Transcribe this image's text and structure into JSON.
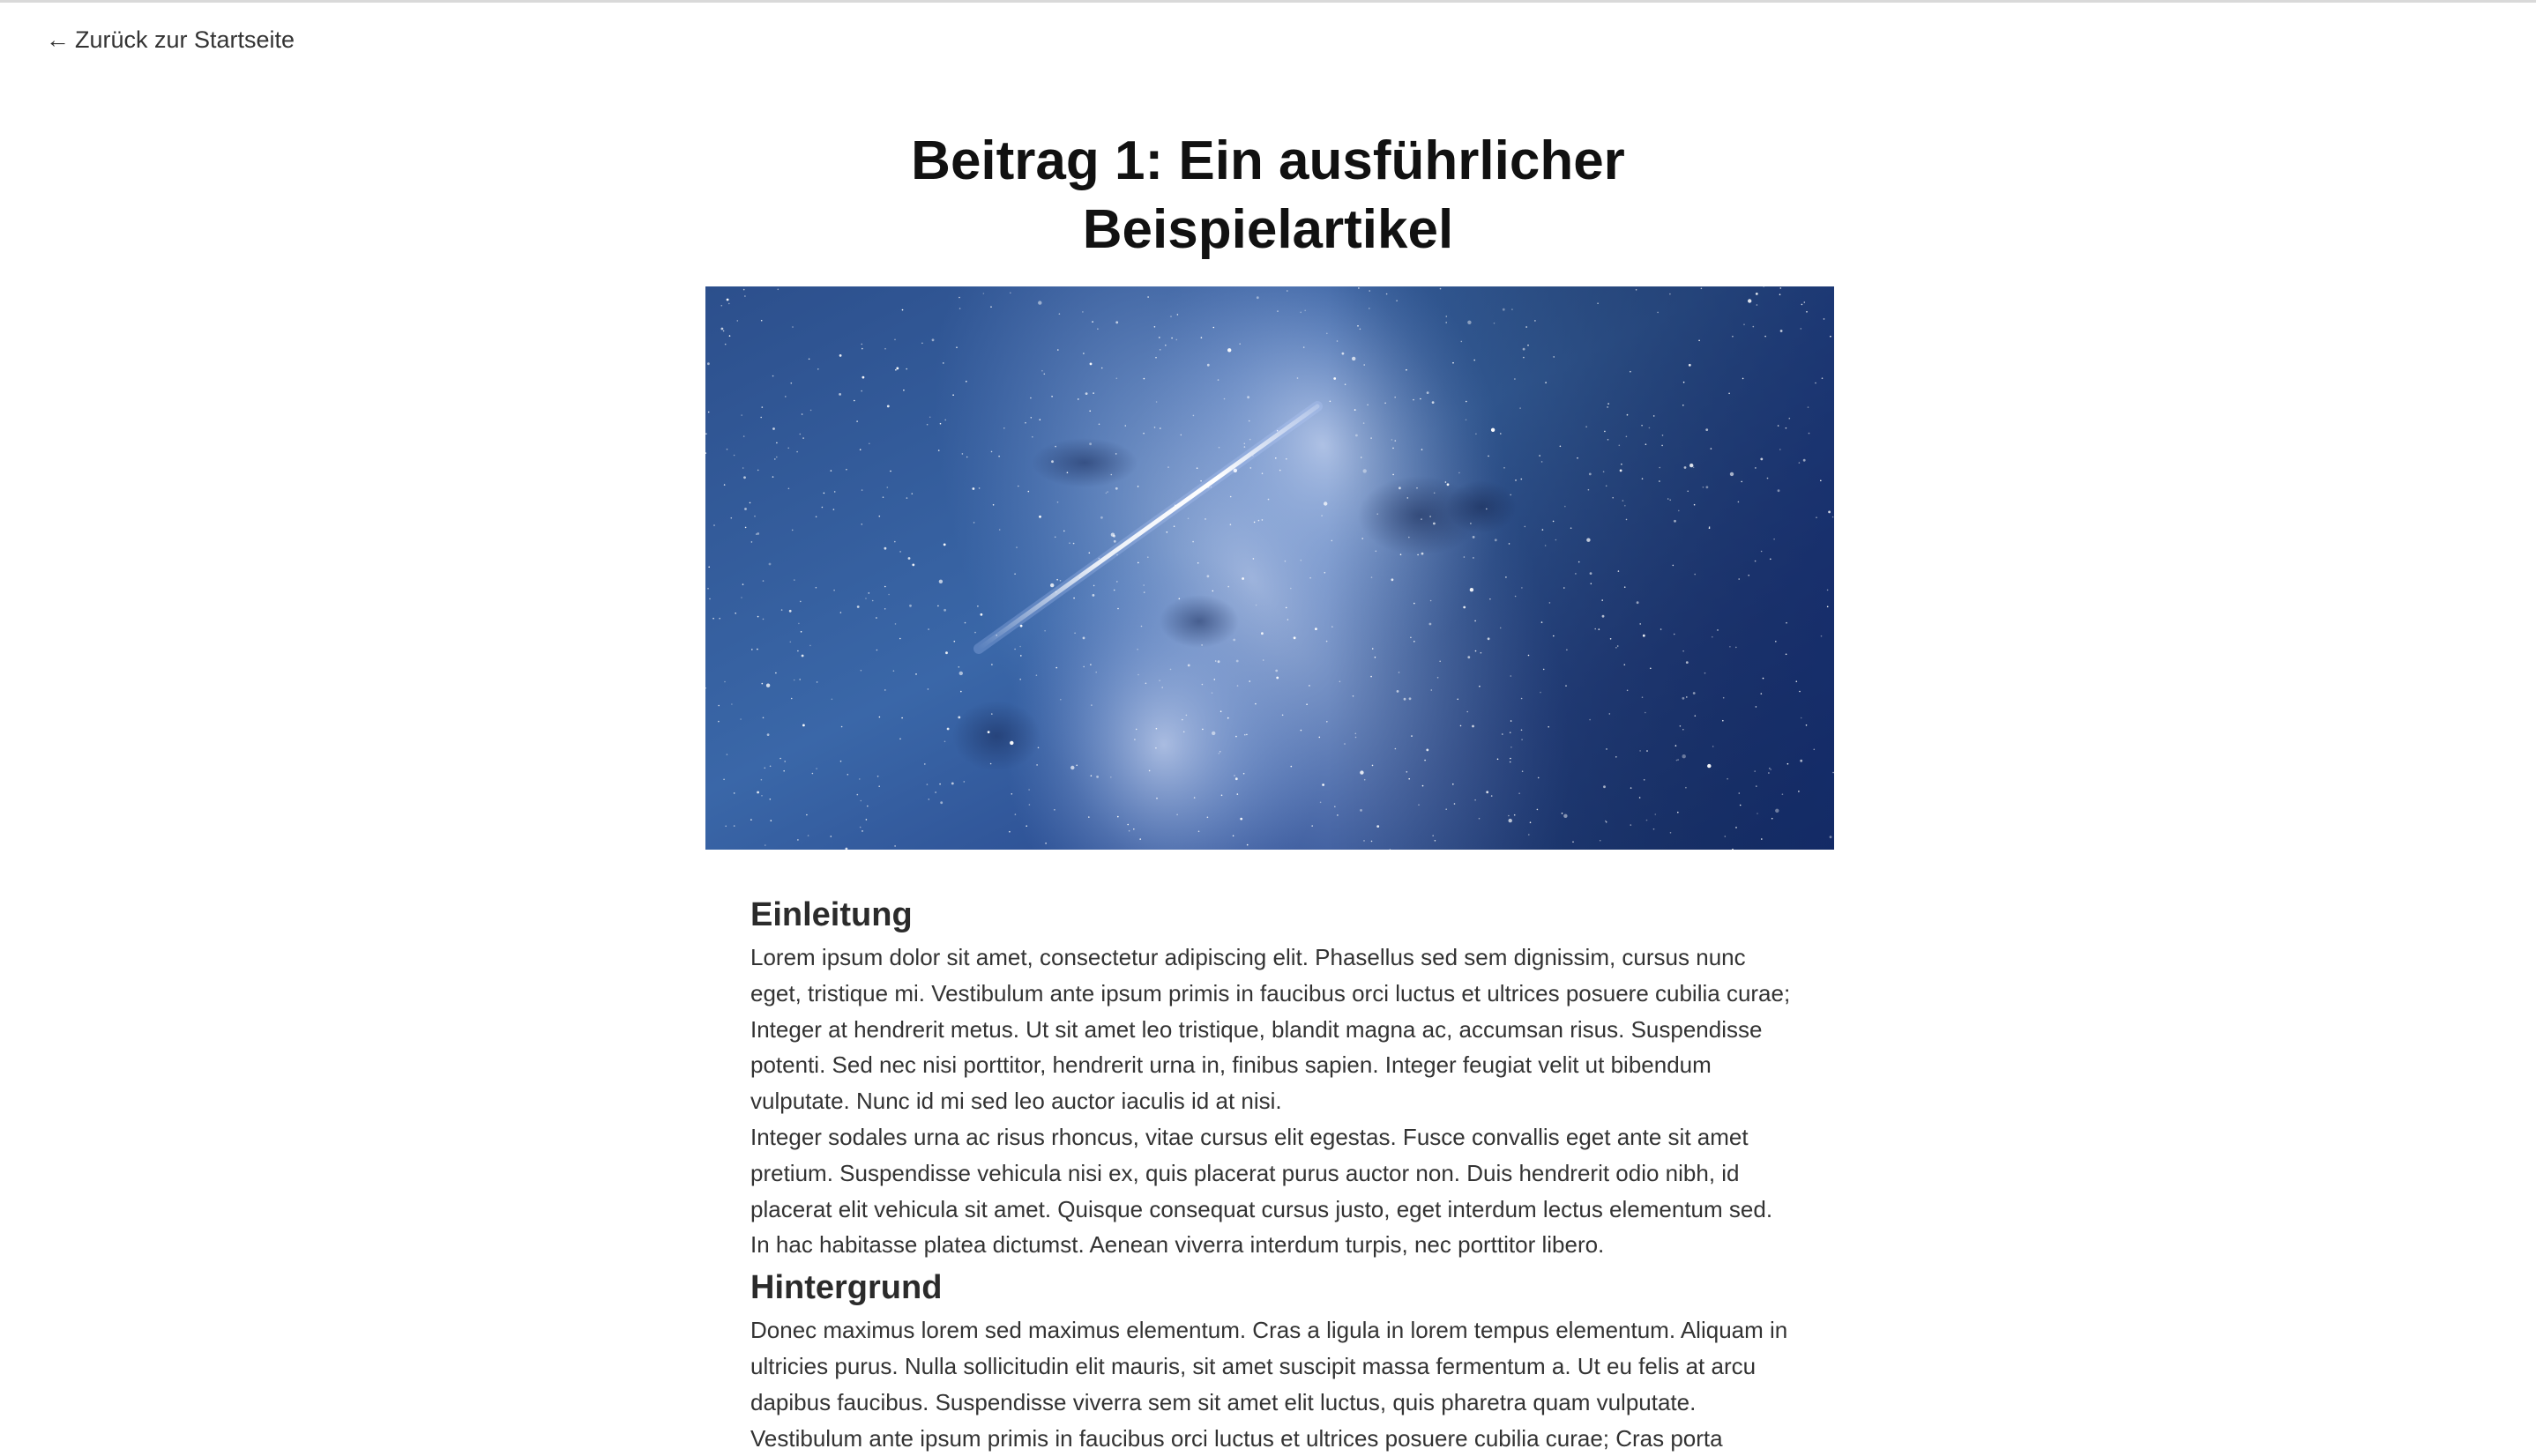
{
  "nav": {
    "back_arrow": "←",
    "back_label": "Zurück zur Startseite"
  },
  "article": {
    "title_line1": "Beitrag 1: Ein ausführlicher",
    "title_line2": "Beispielartikel",
    "hero_image": "starry-night-sky-meteor",
    "sections": [
      {
        "heading": "Einleitung",
        "paragraphs": [
          "Lorem ipsum dolor sit amet, consectetur adipiscing elit. Phasellus sed sem dignissim, cursus nunc eget, tristique mi. Vestibulum ante ipsum primis in faucibus orci luctus et ultrices posuere cubilia curae; Integer at hendrerit metus. Ut sit amet leo tristique, blandit magna ac, accumsan risus. Suspendisse potenti. Sed nec nisi porttitor, hendrerit urna in, finibus sapien. Integer feugiat velit ut bibendum vulputate. Nunc id mi sed leo auctor iaculis id at nisi.",
          "Integer sodales urna ac risus rhoncus, vitae cursus elit egestas. Fusce convallis eget ante sit amet pretium. Suspendisse vehicula nisi ex, quis placerat purus auctor non. Duis hendrerit odio nibh, id placerat elit vehicula sit amet. Quisque consequat cursus justo, eget interdum lectus elementum sed. In hac habitasse platea dictumst. Aenean viverra interdum turpis, nec porttitor libero."
        ]
      },
      {
        "heading": "Hintergrund",
        "paragraphs": [
          "Donec maximus lorem sed maximus elementum. Cras a ligula in lorem tempus elementum. Aliquam in ultricies purus. Nulla sollicitudin elit mauris, sit amet suscipit massa fermentum a. Ut eu felis at arcu dapibus faucibus. Suspendisse viverra sem sit amet elit luctus, quis pharetra quam vulputate. Vestibulum ante ipsum primis in faucibus orci luctus et ultrices posuere cubilia curae; Cras porta"
        ]
      }
    ]
  }
}
